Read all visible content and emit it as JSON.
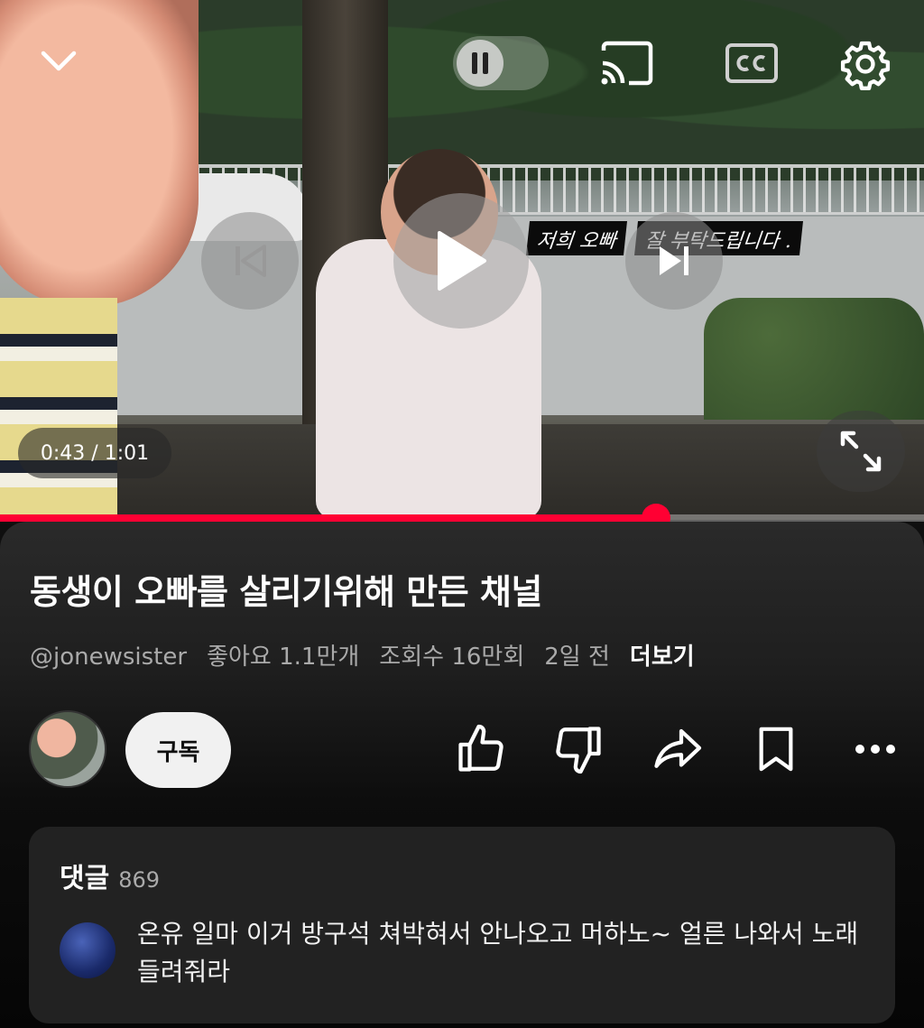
{
  "player": {
    "time_label": "0:43 / 1:01",
    "progress_fraction": 0.71,
    "caption_overlay": [
      "저희 오빠",
      "잘 부탁드립니다 ."
    ]
  },
  "video": {
    "title": "동생이 오빠를 살리기위해 만든 채널",
    "channel": "@jonewsister",
    "likes": "좋아요 1.1만개",
    "views": "조회수 16만회",
    "age": "2일 전",
    "more_label": "더보기"
  },
  "actions": {
    "subscribe_label": "구독"
  },
  "comments": {
    "label": "댓글",
    "count": "869",
    "top_comment": "온유 일마 이거 방구석 쳐박혀서 안나오고 머하노~ 얼른 나와서 노래 들려줘라"
  },
  "colors": {
    "accent": "#ff0033",
    "background": "#0f0f0f"
  }
}
